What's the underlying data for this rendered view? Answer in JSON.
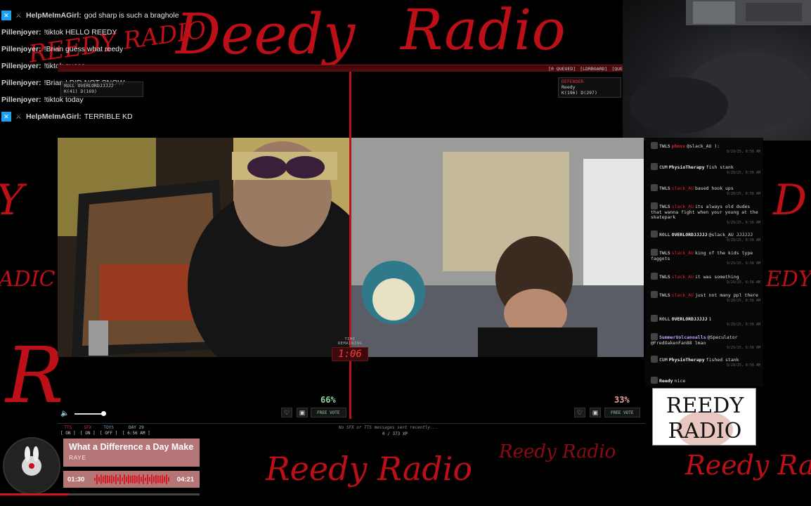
{
  "background": {
    "scribble_top": "REEDY RADIO",
    "scribble_big_1": "Deedy",
    "scribble_big_2": "Radio",
    "scribble_bottom_1": "Reedy Radio",
    "scribble_bottom_2": "Reedy Radio",
    "scribble_bottom_3": "Reedy Radi",
    "accent_color": "#c8101a"
  },
  "overlay_chat": [
    {
      "user": "HelpMeImAGirl:",
      "message": "god sharp is such a braghole",
      "badge": "x-icon"
    },
    {
      "user": "Pillenjoyer:",
      "message": "!tiktok HELLO REEDY",
      "badge": ""
    },
    {
      "user": "Pillenjoyer:",
      "message": "!Brian guess what reedy",
      "badge": ""
    },
    {
      "user": "Pillenjoyer:",
      "message": "!tiktok guess",
      "badge": ""
    },
    {
      "user": "Pillenjoyer:",
      "message": "!Brian I DID NOT SNOW",
      "badge": ""
    },
    {
      "user": "Pillenjoyer:",
      "message": "!tiktok today",
      "badge": ""
    },
    {
      "user": "HelpMeImAGirl:",
      "message": "TERRIBLE KD",
      "badge": "x-icon"
    }
  ],
  "top_bar": {
    "labels": [
      "[0 QUEUED]",
      "[LDRBOARD]",
      "[QUE"
    ]
  },
  "left_user_tag": {
    "role": "ROLL",
    "name": "OVERLORDJJJJJ",
    "stats": "K(41) D(169)"
  },
  "right_user_tag": {
    "role": "DEFENDER",
    "name": "Reedy",
    "stats": "K(196) D(297)"
  },
  "timer": {
    "label": "TIME REMAINING",
    "value": "1:06"
  },
  "vote": {
    "left_pct": "66%",
    "right_pct": "33%",
    "left_label": "FREE VOTE",
    "right_label": "FREE VOTE",
    "left_color": "#8fd2a0",
    "right_color": "#e7a1a1",
    "volume_level": 0.9
  },
  "status": {
    "tts_label": "TTS",
    "tts_value": "[ ON ]",
    "sfx_label": "SFX",
    "sfx_value": "[ ON ]",
    "toys_label": "TOYS",
    "toys_value": "[ OFF ]",
    "day_label": "DAY 29",
    "day_value": "[ 6:56 AM ]",
    "message": "No SFX or TTS messages sent recently...",
    "xp": "0 / 373 XP"
  },
  "side_chat": [
    {
      "tag": "TWLS",
      "name": "phoxv",
      "mention": "",
      "text": "@slack_AU ):",
      "ts": "9/29/25, 6:56 AM"
    },
    {
      "tag": "CUM",
      "name": "PhysioTherapy",
      "mention": "",
      "text": "fish stank",
      "ts": "9/29/25, 6:56 AM"
    },
    {
      "tag": "TWLS",
      "name": "",
      "mention": "slack_AU",
      "text": "based hook ups",
      "ts": "9/29/25, 6:56 AM"
    },
    {
      "tag": "TWLS",
      "name": "",
      "mention": "slack_AU",
      "text": "its always old dudes that wanna fight when your young at the skatepark",
      "ts": "9/29/25, 6:56 AM"
    },
    {
      "tag": "ROLL",
      "name": "OVERLORDJJJJJ",
      "mention": "",
      "text": "@slack_AU JJJJJJ",
      "ts": "9/29/25, 6:56 AM"
    },
    {
      "tag": "TWLS",
      "name": "",
      "mention": "slack_AU",
      "text": "king of the kids type faggots",
      "ts": "9/29/25, 6:56 AM"
    },
    {
      "tag": "TWLS",
      "name": "",
      "mention": "slack_AU",
      "text": "it was something",
      "ts": "9/29/25, 6:56 AM"
    },
    {
      "tag": "TWLS",
      "name": "",
      "mention": "slack_AU",
      "text": "just not many ppl there",
      "ts": "9/29/25, 6:56 AM"
    },
    {
      "tag": "ROLL",
      "name": "OVERLORDJJJJJ",
      "mention": "",
      "text": "1",
      "ts": "9/29/25, 6:56 AM"
    },
    {
      "tag": "",
      "name": "SummerVolcanoalls",
      "mention": "",
      "text": "@Speculator @FredOakenFan88 lmao",
      "ts": "9/29/25, 6:56 AM"
    },
    {
      "tag": "CUM",
      "name": "PhysioTherapy",
      "mention": "",
      "text": "fished stank",
      "ts": "9/29/25, 6:56 AM"
    },
    {
      "tag": "",
      "name": "Reedy",
      "mention": "",
      "text": "nice",
      "ts": ""
    }
  ],
  "logo": {
    "line1": "REEDY",
    "line2": "RADIO"
  },
  "now_playing": {
    "title": "What a Difference a Day Makes",
    "artist": "RAYE",
    "elapsed": "01:30",
    "duration": "04:21",
    "progress": 0.345,
    "album_text": "BLACK RABBIT"
  }
}
